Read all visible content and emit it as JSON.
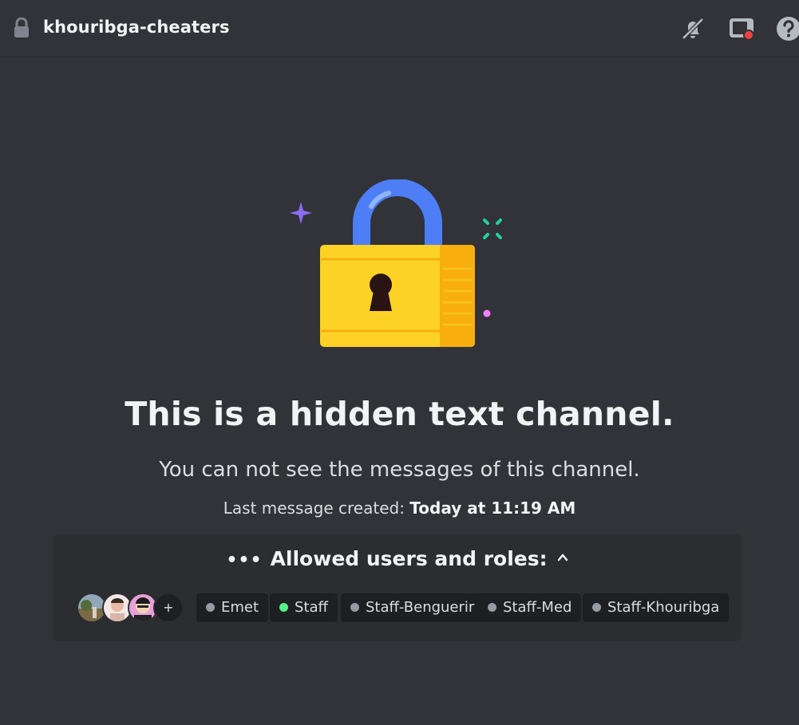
{
  "header": {
    "channel_name": "khouribga-cheaters",
    "icons": [
      "lock-icon",
      "mute-bell-icon",
      "screen-share-icon",
      "help-icon"
    ]
  },
  "main": {
    "title": "This is a hidden text channel.",
    "subtitle": "You can not see the messages of this channel.",
    "last_message_label": "Last message created:",
    "last_message_value": "Today at 11:19 AM"
  },
  "allowed": {
    "dots": "•••",
    "heading": "Allowed users and roles:",
    "more_label": "+",
    "roles": [
      {
        "name": "Emet",
        "color": "#949ba4"
      },
      {
        "name": "Staff",
        "color": "#57f287"
      },
      {
        "name": "Staff-Benguerir",
        "color": "#949ba4"
      },
      {
        "name": "Staff-Med",
        "color": "#949ba4"
      },
      {
        "name": "Staff-Khouribga",
        "color": "#949ba4"
      }
    ]
  },
  "colors": {
    "background": "#313338",
    "panel": "#2b2d31",
    "chip": "#1e1f22",
    "lock_body": "#fcd227",
    "lock_shackle": "#4e7ef6",
    "alert_red": "#f23f42"
  }
}
